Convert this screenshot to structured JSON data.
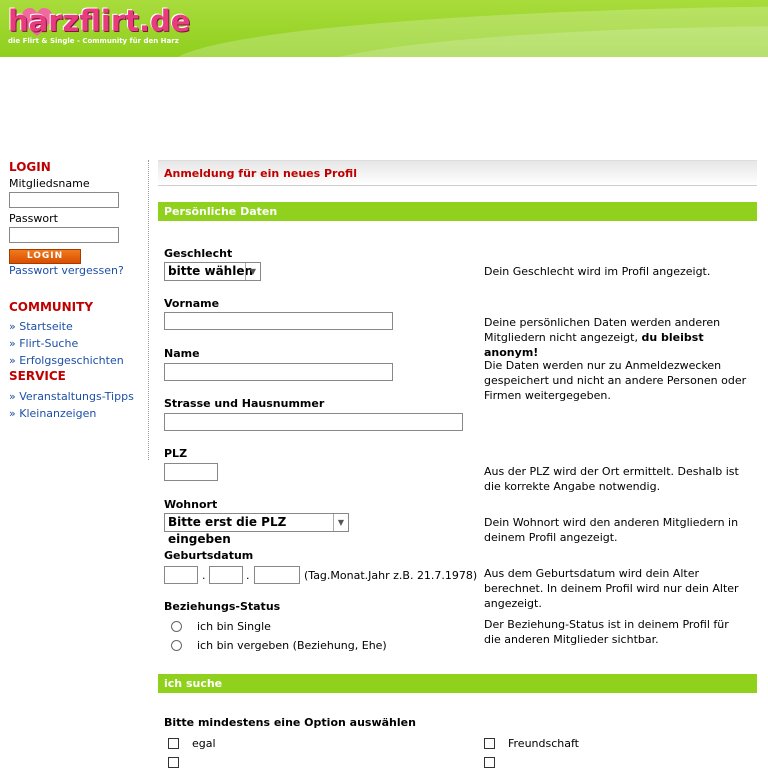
{
  "header": {
    "logo_text": "harzflirt.de",
    "tagline": "die Flirt & Single - Community für den Harz"
  },
  "sidebar": {
    "login_title": "LOGIN",
    "member_label": "Mitgliedsname",
    "password_label": "Passwort",
    "login_button": "LOGIN",
    "forgot_link": "Passwort vergessen?",
    "community_title": "COMMUNITY",
    "community_links": [
      "» Startseite",
      "» Flirt-Suche",
      "» Erfolgsgeschichten"
    ],
    "service_title": "SERVICE",
    "service_links": [
      "» Veranstaltungs-Tipps",
      "» Kleinanzeigen"
    ]
  },
  "main": {
    "page_heading": "Anmeldung für ein neues Profil",
    "section_personal": "Persönliche Daten",
    "gender_label": "Geschlecht",
    "gender_value": "bitte wählen",
    "gender_desc": "Dein Geschlecht wird im Profil angezeigt.",
    "firstname_label": "Vorname",
    "name_desc_prefix": "Deine persönlichen Daten werden anderen Mitgliedern nicht angezeigt, ",
    "name_desc_bold": "du bleibst anonym!",
    "name_label": "Name",
    "name_desc2": "Die Daten werden nur zu Anmeldezwecken gespeichert und nicht an andere Personen oder Firmen weitergegeben.",
    "street_label": "Strasse und Hausnummer",
    "plz_label": "PLZ",
    "plz_desc": "Aus der PLZ wird der Ort ermittelt. Deshalb ist die korrekte Angabe notwendig.",
    "city_label": "Wohnort",
    "city_value": "Bitte erst die PLZ eingeben",
    "city_desc": "Dein Wohnort wird den anderen Mitgliedern in deinem Profil angezeigt.",
    "birth_label": "Geburtsdatum",
    "birth_hint": "(Tag.Monat.Jahr z.B. 21.7.1978)",
    "birth_desc": "Aus dem Geburtsdatum wird dein Alter berechnet. In deinem Profil wird nur dein Alter angezeigt.",
    "relationship_label": "Beziehungs-Status",
    "relationship_options": [
      "ich bin Single",
      "ich bin vergeben (Beziehung, Ehe)"
    ],
    "relationship_desc": "Der Beziehung-Status ist in deinem Profil für die anderen Mitglieder sichtbar.",
    "section_search": "ich suche",
    "search_prompt": "Bitte mindestens eine Option auswählen",
    "search_options": [
      "egal",
      "Freundschaft"
    ]
  }
}
